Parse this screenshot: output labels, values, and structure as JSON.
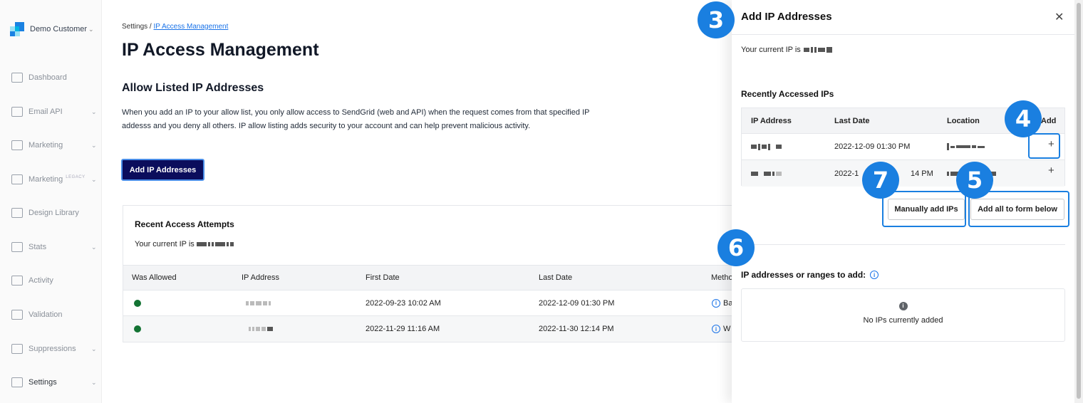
{
  "sidebar": {
    "account": "Demo Customer",
    "items": [
      {
        "label": "Dashboard",
        "icon": "gauge-icon",
        "chevron": false
      },
      {
        "label": "Email API",
        "icon": "terminal-icon",
        "chevron": true
      },
      {
        "label": "Marketing",
        "icon": "megaphone-icon",
        "chevron": true
      },
      {
        "label": "Marketing",
        "badge": "LEGACY",
        "icon": "megaphone-icon",
        "chevron": true
      },
      {
        "label": "Design Library",
        "icon": "design-tools-icon",
        "chevron": false
      },
      {
        "label": "Stats",
        "icon": "bar-chart-icon",
        "chevron": true
      },
      {
        "label": "Activity",
        "icon": "mail-search-icon",
        "chevron": false
      },
      {
        "label": "Validation",
        "icon": "at-check-icon",
        "chevron": false
      },
      {
        "label": "Suppressions",
        "icon": "mail-block-icon",
        "chevron": true
      },
      {
        "label": "Settings",
        "icon": "sliders-icon",
        "chevron": true,
        "active": true
      }
    ]
  },
  "breadcrumb": {
    "root": "Settings",
    "sep": "/",
    "current": "IP Access Management"
  },
  "page": {
    "title": "IP Access Management",
    "section_title": "Allow Listed IP Addresses",
    "description": "When you add an IP to your allow list, you only allow access to SendGrid (web and API) when the request comes from that specified IP addesss and you deny all others. IP allow listing adds security to your account and can help prevent malicious activity.",
    "add_button": "Add IP Addresses"
  },
  "attempts": {
    "title": "Recent Access Attempts",
    "current_ip_label": "Your current IP is",
    "columns": [
      "Was Allowed",
      "IP Address",
      "First Date",
      "Last Date",
      "Metho"
    ],
    "rows": [
      {
        "allowed": true,
        "first": "2022-09-23 10:02 AM",
        "last": "2022-12-09 01:30 PM",
        "method": "Ba"
      },
      {
        "allowed": true,
        "first": "2022-11-29 11:16 AM",
        "last": "2022-11-30 12:14 PM",
        "method": "W"
      }
    ]
  },
  "panel": {
    "title": "Add IP Addresses",
    "current_ip_label": "Your current IP is",
    "recent_title": "Recently Accessed IPs",
    "columns": [
      "IP Address",
      "Last Date",
      "Location",
      "Add"
    ],
    "rows": [
      {
        "last": "2022-12-09 01:30 PM",
        "add": "+"
      },
      {
        "last": "2022-1",
        "last_tail": "14 PM",
        "add": "+"
      }
    ],
    "manual_button": "Manually add IPs",
    "add_all_button": "Add all to form below",
    "ranges_label": "IP addresses or ranges to add:",
    "empty_text": "No IPs currently added"
  },
  "annotations": [
    "3",
    "4",
    "5",
    "6",
    "7"
  ],
  "colors": {
    "accent": "#1a7fe0",
    "primary_button": "#0b0d5c",
    "allowed": "#137333",
    "link": "#1a73e8"
  }
}
